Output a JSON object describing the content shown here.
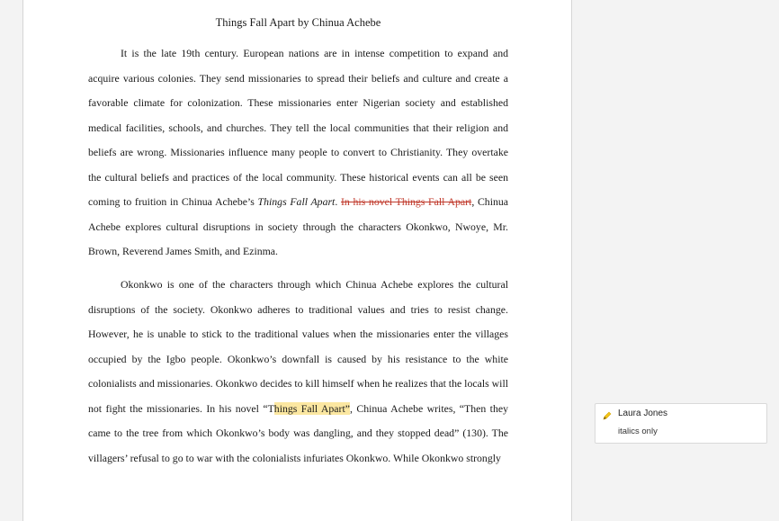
{
  "document": {
    "title": "Things Fall Apart by Chinua Achebe",
    "paragraph1": {
      "part1": "It is the late 19th century. European nations are in intense competition to expand and acquire various colonies. They send missionaries to spread their beliefs and culture and create a favorable climate for colonization. These missionaries enter Nigerian society and established medical facilities, schools, and churches. They tell the local communities that their religion and beliefs are wrong. Missionaries influence many people to convert to Christianity.  They overtake the cultural beliefs and practices of the local community. These historical events can all be seen coming to fruition in Chinua Achebe’s ",
      "italic_title": "Things Fall Apart",
      "period": ". ",
      "deleted": "In his novel Things Fall Apart",
      "part2": ", Chinua Achebe explores cultural disruptions in society through the characters Okonkwo, Nwoye, Mr. Brown, Reverend James Smith, and Ezinma."
    },
    "paragraph2": {
      "part1": "Okonkwo is one of the characters through which Chinua Achebe explores the cultural disruptions of the society. Okonkwo adheres to traditional values and tries to resist change. However, he is unable to stick to the traditional values when the missionaries enter the villages occupied by the Igbo people. Okonkwo’s downfall is caused by his resistance to the white colonialists and missionaries. Okonkwo decides to kill himself when he realizes that the locals will not fight the missionaries. In his novel “T",
      "highlight": "hings Fall Apart”",
      "part2": ", Chinua Achebe writes, “Then they came to the tree from which Okonkwo’s body was dangling, and they stopped dead” (130). The villagers’ refusal to go to war with the colonialists infuriates Okonkwo. While Okonkwo strongly"
    }
  },
  "comment": {
    "author": "Laura Jones",
    "text": "italics only",
    "icon": "pencil-icon",
    "icon_color": "#f5c518"
  },
  "colors": {
    "highlight": "#fbe7a1",
    "deletion": "#c0392b"
  }
}
